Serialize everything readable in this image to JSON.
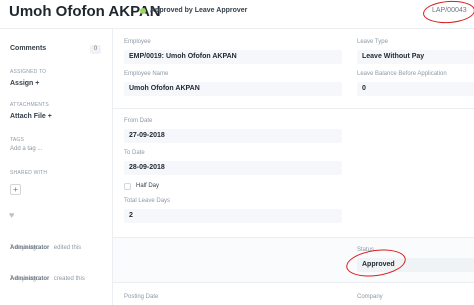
{
  "header": {
    "title": "Umoh Ofofon AKPAN",
    "status": "Approved by Leave Approver",
    "status_color": "#98d85b",
    "docname": "LAP/00043",
    "annotation_color": "#d81e1e"
  },
  "sidebar": {
    "comments_label": "Comments",
    "comments_count": "0",
    "assigned_to_label": "ASSIGNED TO",
    "assign_label": "Assign +",
    "attachments_label": "ATTACHMENTS",
    "attach_file_label": "Attach File +",
    "tags_label": "TAGS",
    "add_tag_placeholder": "Add a tag ...",
    "shared_with_label": "SHARED WITH",
    "share_button_label": "+",
    "like_icon": "heart-icon",
    "activity": [
      {
        "user": "Administrator",
        "action": "edited this",
        "time": "7 days ago"
      },
      {
        "user": "Administrator",
        "action": "created this",
        "time": "7 days ago"
      }
    ]
  },
  "form": {
    "employee_label": "Employee",
    "employee_value": "EMP/0019: Umoh Ofofon AKPAN",
    "employee_name_label": "Employee Name",
    "employee_name_value": "Umoh Ofofon AKPAN",
    "leave_type_label": "Leave Type",
    "leave_type_value": "Leave Without Pay",
    "leave_balance_label": "Leave Balance Before Application",
    "leave_balance_value": "0",
    "from_date_label": "From Date",
    "from_date_value": "27-09-2018",
    "to_date_label": "To Date",
    "to_date_value": "28-09-2018",
    "half_day_label": "Half Day",
    "total_leave_days_label": "Total Leave Days",
    "total_leave_days_value": "2",
    "status_label": "Status",
    "status_value": "Approved",
    "posting_date_label": "Posting Date",
    "company_label": "Company"
  }
}
